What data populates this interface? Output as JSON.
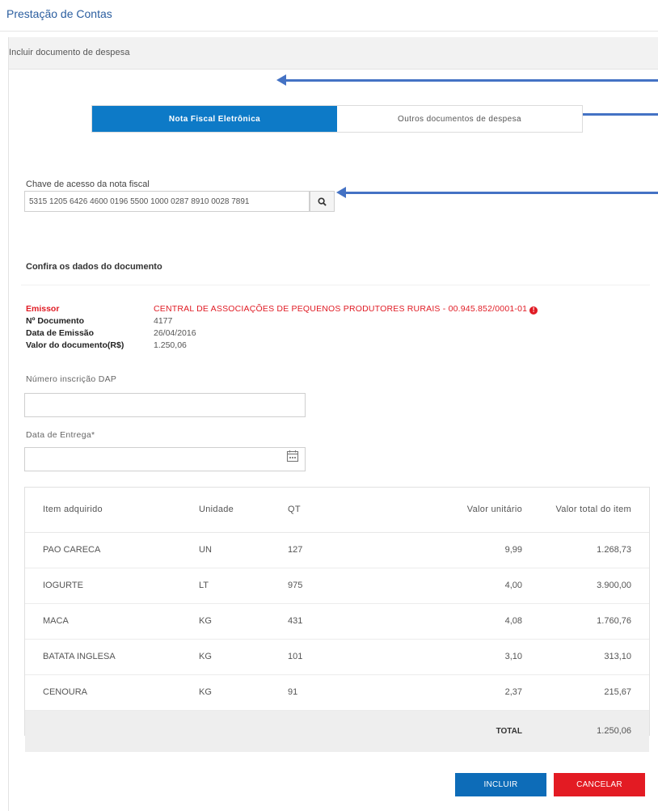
{
  "page": {
    "title": "Prestação de Contas"
  },
  "panel": {
    "header": "Incluir documento de despesa"
  },
  "tabs": [
    {
      "label": "Nota Fiscal Eletrônica",
      "active": true
    },
    {
      "label": "Outros documentos de despesa",
      "active": false
    }
  ],
  "access_key": {
    "label": "Chave de acesso da nota fiscal",
    "value": "5315 1205 6426 4600 0196 5500 1000 0287 8910 0028 7891",
    "search_icon": "search-icon"
  },
  "document": {
    "section_title": "Confira os dados do documento",
    "issuer_label": "Emissor",
    "issuer_value": "CENTRAL DE ASSOCIAÇÕES DE PEQUENOS PRODUTORES RURAIS - 00.945.852/0001-01",
    "issuer_warning_icon": "warning-icon",
    "number_label": "Nº Documento",
    "number_value": "4177",
    "date_label": "Data de Emissão",
    "date_value": "26/04/2016",
    "amount_label": "Valor do documento(R$)",
    "amount_value": "1.250,06",
    "colors": {
      "alert": "#e01b24"
    }
  },
  "dap": {
    "label": "Número inscrição DAP",
    "value": ""
  },
  "delivery": {
    "label": "Data de Entrega*",
    "value": "",
    "icon": "calendar-icon"
  },
  "items_table": {
    "headers": [
      "Item adquirido",
      "Unidade",
      "QT",
      "Valor unitário",
      "Valor total do item"
    ],
    "rows": [
      [
        "PAO CARECA",
        "UN",
        "127",
        "9,99",
        "1.268,73"
      ],
      [
        "IOGURTE",
        "LT",
        "975",
        "4,00",
        "3.900,00"
      ],
      [
        "MACA",
        "KG",
        "431",
        "4,08",
        "1.760,76"
      ],
      [
        "BATATA INGLESA",
        "KG",
        "101",
        "3,10",
        "313,10"
      ],
      [
        "CENOURA",
        "KG",
        "91",
        "2,37",
        "215,67"
      ]
    ],
    "total_label": "TOTAL",
    "total_value": "1.250,06"
  },
  "actions": {
    "include": "INCLUIR",
    "cancel": "CANCELAR"
  },
  "colors": {
    "primary": "#0d7ac7",
    "danger": "#e31b23",
    "annotation": "#4472c4"
  }
}
